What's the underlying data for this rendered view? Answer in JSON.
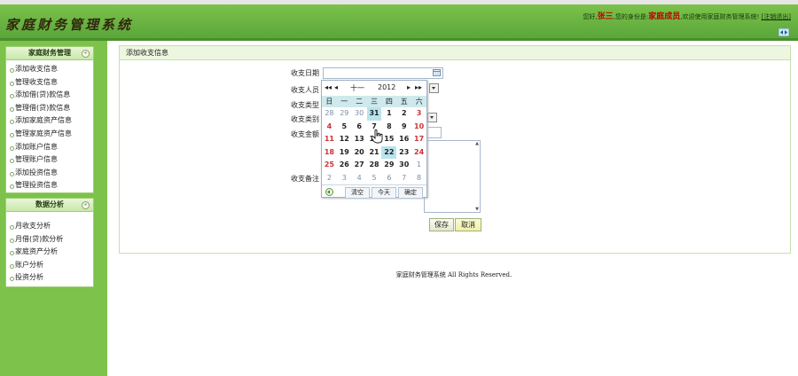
{
  "header": {
    "logo": "家庭财务管理系统",
    "greeting": "您好,",
    "username": "张三",
    "identity_prefix": ",您的身份是:",
    "role": "家庭成员",
    "welcome": ",欢迎使用家庭财务管理系统!",
    "logout": "[注销退出]",
    "toggle_icon": "collapse-arrows-icon"
  },
  "sidebar": {
    "panels": [
      {
        "title": "家庭财务管理",
        "items": [
          "添加收支信息",
          "管理收支信息",
          "添加借(贷)款信息",
          "管理借(贷)款信息",
          "添加家庭资产信息",
          "管理家庭资产信息",
          "添加账户信息",
          "管理账户信息",
          "添加投资信息",
          "管理投资信息"
        ]
      },
      {
        "title": "数据分析",
        "items": [
          "月收支分析",
          "月借(贷)款分析",
          "家庭资产分析",
          "账户分析",
          "投资分析"
        ]
      }
    ]
  },
  "main": {
    "title": "添加收支信息",
    "fields": {
      "date_label": "收支日期",
      "person_label": "收支人员",
      "type_label": "收支类型",
      "category_label": "收支类别",
      "amount_label": "收支金额",
      "note_label": "收支备注"
    },
    "save_label": "保存",
    "cancel_label": "取消"
  },
  "calendar": {
    "month": "十一",
    "year": "2012",
    "weekdays": [
      "日",
      "一",
      "二",
      "三",
      "四",
      "五",
      "六"
    ],
    "rows": [
      [
        "28",
        "29",
        "30",
        "31",
        "1",
        "2",
        "3"
      ],
      [
        "4",
        "5",
        "6",
        "7",
        "8",
        "9",
        "10"
      ],
      [
        "11",
        "12",
        "13",
        "14",
        "15",
        "16",
        "17"
      ],
      [
        "18",
        "19",
        "20",
        "21",
        "22",
        "23",
        "24"
      ],
      [
        "25",
        "26",
        "27",
        "28",
        "29",
        "30",
        "1"
      ],
      [
        "2",
        "3",
        "4",
        "5",
        "6",
        "7",
        "8"
      ]
    ],
    "clear_label": "清空",
    "today_label": "今天",
    "ok_label": "确定"
  },
  "footer": "家庭财务管理系统 All Rights Reserved."
}
